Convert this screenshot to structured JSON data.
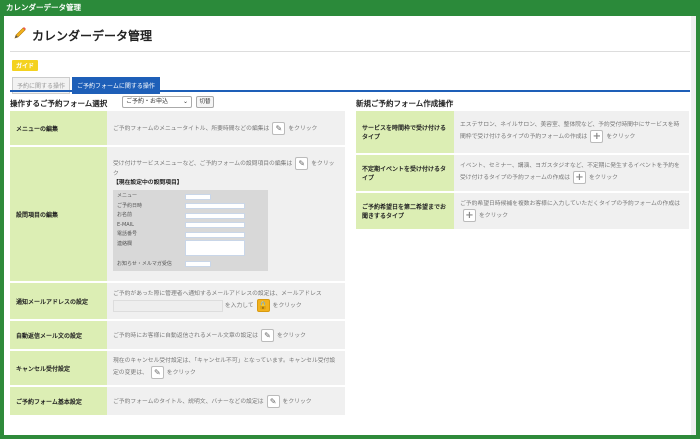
{
  "window_title": "カレンダーデータ管理",
  "page_title": "カレンダーデータ管理",
  "guide_label": "ガイド",
  "tabs": [
    "予約に関する操作",
    "ご予約フォームに関する操作"
  ],
  "left": {
    "heading": "操作するご予約フォーム選択",
    "select_value": "ご予約・お申込",
    "switch_label": "切替",
    "rows": {
      "menu": {
        "label": "メニューの編集",
        "text1": "ご予約フォームのメニュータイトル、所要時間などの編集は",
        "text2": "をクリック"
      },
      "setting": {
        "label": "設問項目の編集",
        "text1": "受け付けサービスメニューなど、ご予約フォームの設問項目の編集は",
        "text2": "をクリック",
        "current": "【現在設定中の設問項目】",
        "fields": [
          "メニュー",
          "ご予約日時",
          "お名前",
          "E-MAIL",
          "電話番号",
          "連絡欄",
          "お知らせ・メルマガ受信"
        ]
      },
      "notify": {
        "label": "通知メールアドレスの設定",
        "text1": "ご予約があった際に管理者へ通知するメールアドレスの設定は、メールアドレス",
        "text2": "を入力して",
        "text3": "をクリック"
      },
      "auto_reply": {
        "label": "自動返信メール文の設定",
        "text1": "ご予約時にお客様に自動返信されるメール文章の設定は",
        "text2": "をクリック"
      },
      "cancel": {
        "label": "キャンセル受付設定",
        "text1": "現在のキャンセル受付設定は、「キャンセル不可」となっています。キャンセル受付設定の変更は、",
        "text2": "をクリック"
      },
      "basic": {
        "label": "ご予約フォーム基本設定",
        "text1": "ご予約フォームのタイトル、説明文、バナーなどの設定は",
        "text2": "をクリック"
      }
    }
  },
  "right": {
    "heading": "新規ご予約フォーム作成操作",
    "rows": [
      {
        "label": "サービスを時間枠で受け付けるタイプ",
        "text1": "エステサロン、ネイルサロン、美容室、整体院など、予約受付時間中にサービスを時間枠で受け付けるタイプの予約フォームの作成は",
        "text2": "をクリック"
      },
      {
        "label": "不定期イベントを受け付けるタイプ",
        "text1": "イベント、セミナー、講演、ヨガスタジオなど、不定期に発生するイベントを予約を受け付けるタイプの予約フォームの作成は",
        "text2": "をクリック"
      },
      {
        "label": "ご予約希望日を第二希望までお聞きするタイプ",
        "text1": "ご予約希望日時候補を複数お客様に入力していただくタイプの予約フォームの作成は",
        "text2": "をクリック"
      }
    ]
  }
}
